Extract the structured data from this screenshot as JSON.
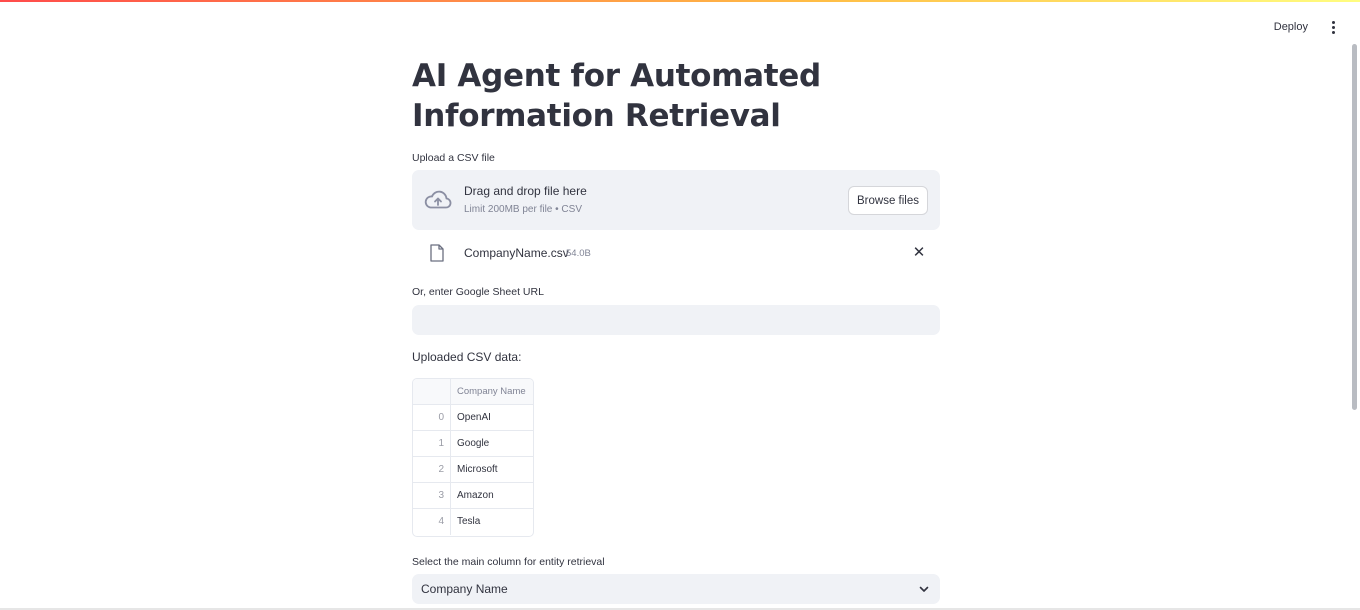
{
  "header": {
    "deploy_label": "Deploy",
    "menu_icon": "vertical-ellipsis-icon"
  },
  "page": {
    "title": "AI Agent for Automated Information Retrieval"
  },
  "uploader": {
    "label": "Upload a CSV file",
    "drop_text": "Drag and drop file here",
    "limit_text": "Limit 200MB per file • CSV",
    "browse_label": "Browse files",
    "icon": "cloud-upload-icon"
  },
  "uploaded_file": {
    "name": "CompanyName.csv",
    "size": "54.0B",
    "icon": "file-icon",
    "remove_icon": "close-icon"
  },
  "google_sheet": {
    "label": "Or, enter Google Sheet URL",
    "value": "",
    "placeholder": ""
  },
  "csv_preview": {
    "label": "Uploaded CSV data:",
    "columns": [
      "",
      "Company Name"
    ],
    "rows": [
      {
        "index": "0",
        "company": "OpenAI"
      },
      {
        "index": "1",
        "company": "Google"
      },
      {
        "index": "2",
        "company": "Microsoft"
      },
      {
        "index": "3",
        "company": "Amazon"
      },
      {
        "index": "4",
        "company": "Tesla"
      }
    ]
  },
  "column_select": {
    "label": "Select the main column for entity retrieval",
    "value": "Company Name",
    "icon": "chevron-down-icon"
  },
  "colors": {
    "primary": "#ff4b4b",
    "text": "#31333f",
    "widget_bg": "#f0f2f6",
    "muted": "#808495"
  }
}
